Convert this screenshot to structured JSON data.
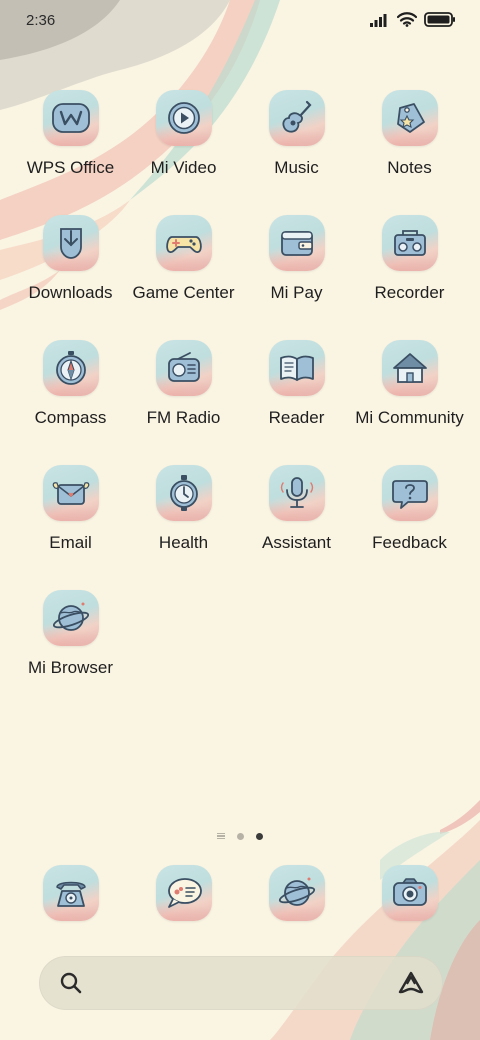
{
  "status_bar": {
    "time": "2:36",
    "icons": [
      "signal-icon",
      "wifi-icon",
      "battery-icon"
    ]
  },
  "apps": [
    {
      "label": "WPS Office",
      "icon": "wps-office-icon"
    },
    {
      "label": "Mi Video",
      "icon": "play-icon"
    },
    {
      "label": "Music",
      "icon": "guitar-icon"
    },
    {
      "label": "Notes",
      "icon": "note-tag-icon"
    },
    {
      "label": "Downloads",
      "icon": "download-icon"
    },
    {
      "label": "Game Center",
      "icon": "gamepad-icon"
    },
    {
      "label": "Mi Pay",
      "icon": "wallet-icon"
    },
    {
      "label": "Recorder",
      "icon": "boombox-icon"
    },
    {
      "label": "Compass",
      "icon": "compass-icon"
    },
    {
      "label": "FM Radio",
      "icon": "radio-icon"
    },
    {
      "label": "Reader",
      "icon": "book-icon"
    },
    {
      "label": "Mi Community",
      "icon": "house-icon"
    },
    {
      "label": "Email",
      "icon": "envelope-icon"
    },
    {
      "label": "Health",
      "icon": "stopwatch-icon"
    },
    {
      "label": "Assistant",
      "icon": "microphone-icon"
    },
    {
      "label": "Feedback",
      "icon": "chat-question-icon"
    },
    {
      "label": "Mi Browser",
      "icon": "planet-icon"
    }
  ],
  "page_indicator": {
    "pages": 2,
    "active_page": 2
  },
  "dock": [
    {
      "icon": "phone-icon"
    },
    {
      "icon": "message-bubble-icon"
    },
    {
      "icon": "planet-icon"
    },
    {
      "icon": "camera-icon"
    }
  ],
  "search_bar": {
    "left_icon": "search-icon",
    "right_icon": "assistant-icon"
  },
  "colors": {
    "background": "#faf4e3",
    "icon_line": "#3b4f63",
    "icon_fill": "#9fbfd6",
    "accent_pink": "#e9a5a0",
    "accent_teal": "#bfdede"
  }
}
